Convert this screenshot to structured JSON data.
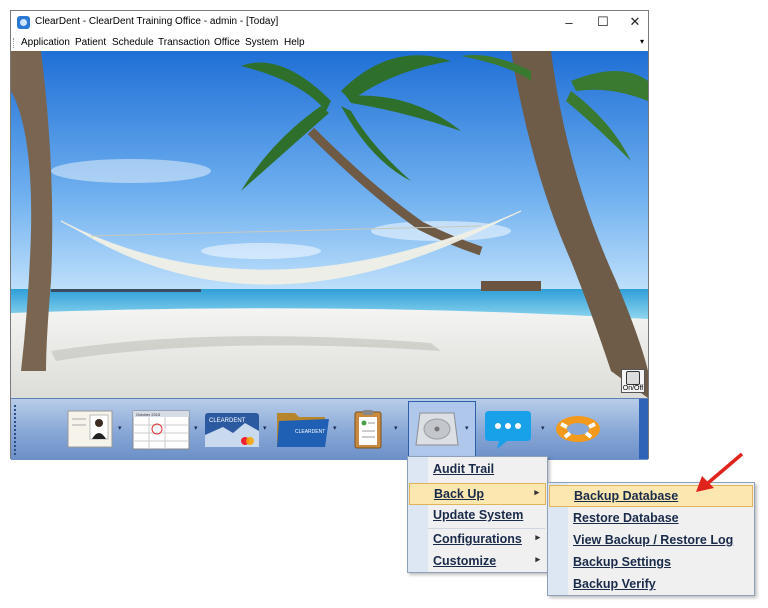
{
  "window": {
    "title": "ClearDent - ClearDent Training Office - admin - [Today]",
    "minimize": "–",
    "maximize": "☐",
    "close": "✕"
  },
  "menubar": {
    "items": [
      "Application",
      "Patient",
      "Schedule",
      "Transaction",
      "Office",
      "System",
      "Help"
    ]
  },
  "onoff": {
    "label": "On/Off"
  },
  "toolbar": {
    "tools": [
      "patient-photo",
      "calendar-schedule",
      "cleardent-payment-card",
      "patient-folders",
      "clipboard-chart",
      "hard-drive-system",
      "chat-bubbles",
      "lifebuoy-help"
    ],
    "card_text": "CLEARDENT",
    "folder_text": "CLEARDENT",
    "calendar_header": "October 2015"
  },
  "system_menu": {
    "items": [
      {
        "label": "Audit Trail",
        "submenu": false
      },
      {
        "label": "Back Up",
        "submenu": true,
        "highlighted": true
      },
      {
        "label": "Update System",
        "submenu": false
      },
      {
        "label": "Configurations",
        "submenu": true
      },
      {
        "label": "Customize",
        "submenu": true
      }
    ],
    "arrow": "▸"
  },
  "backup_submenu": {
    "items": [
      {
        "label": "Backup Database",
        "highlighted": true
      },
      {
        "label": "Restore Database"
      },
      {
        "label": "View Backup / Restore Log"
      },
      {
        "label": "Backup Settings"
      },
      {
        "label": "Backup Verify"
      }
    ]
  },
  "colors": {
    "highlight": "#fce7b1",
    "pointer_arrow": "#e0241c",
    "dock": "#87a7d6"
  }
}
